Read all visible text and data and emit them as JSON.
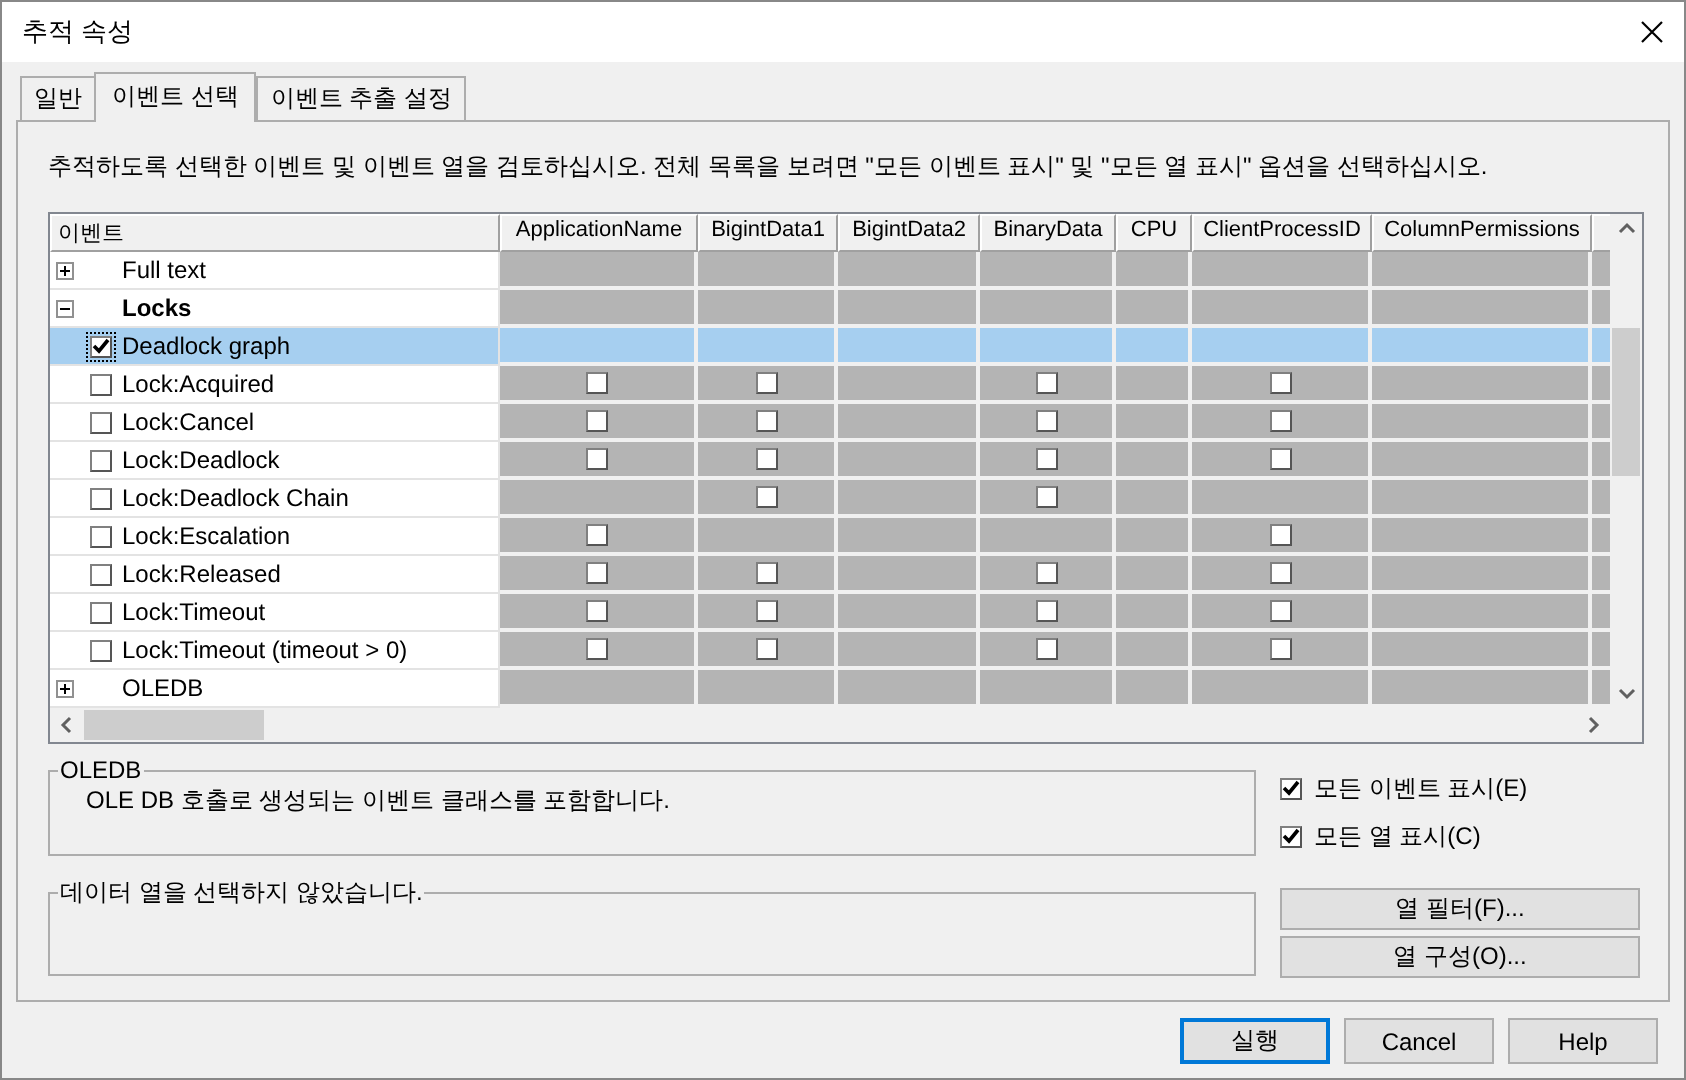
{
  "window": {
    "title": "추적 속성"
  },
  "tabs": [
    {
      "label": "일반",
      "selected": false
    },
    {
      "label": "이벤트 선택",
      "selected": true
    },
    {
      "label": "이벤트 추출 설정",
      "selected": false
    }
  ],
  "instructions": "추적하도록 선택한 이벤트 및 이벤트 열을 검토하십시오. 전체 목록을 보려면 \"모든 이벤트 표시\" 및 \"모든 열 표시\" 옵션을 선택하십시오.",
  "grid": {
    "event_header": "이벤트",
    "columns": [
      "ApplicationName",
      "BigintData1",
      "BigintData2",
      "BinaryData",
      "CPU",
      "ClientProcessID",
      "ColumnPermissions"
    ],
    "rows": [
      {
        "kind": "category",
        "label": "Full text",
        "expanded": false,
        "has_selected_events": false,
        "selected": false
      },
      {
        "kind": "category",
        "label": "Locks",
        "expanded": true,
        "has_selected_events": true,
        "selected": false
      },
      {
        "kind": "event",
        "label": "Deadlock graph",
        "checked": true,
        "selected": true,
        "cells": [
          {
            "kind": "blank"
          },
          {
            "kind": "blank"
          },
          {
            "kind": "blank"
          },
          {
            "kind": "blank"
          },
          {
            "kind": "blank"
          },
          {
            "kind": "blank"
          },
          {
            "kind": "blank"
          }
        ]
      },
      {
        "kind": "event",
        "label": "Lock:Acquired",
        "checked": false,
        "selected": false,
        "cells": [
          {
            "kind": "checkbox",
            "checked": false
          },
          {
            "kind": "checkbox",
            "checked": false
          },
          {
            "kind": "blank"
          },
          {
            "kind": "checkbox",
            "checked": false
          },
          {
            "kind": "blank"
          },
          {
            "kind": "checkbox",
            "checked": false
          },
          {
            "kind": "blank"
          }
        ]
      },
      {
        "kind": "event",
        "label": "Lock:Cancel",
        "checked": false,
        "selected": false,
        "cells": [
          {
            "kind": "checkbox",
            "checked": false
          },
          {
            "kind": "checkbox",
            "checked": false
          },
          {
            "kind": "blank"
          },
          {
            "kind": "checkbox",
            "checked": false
          },
          {
            "kind": "blank"
          },
          {
            "kind": "checkbox",
            "checked": false
          },
          {
            "kind": "blank"
          }
        ]
      },
      {
        "kind": "event",
        "label": "Lock:Deadlock",
        "checked": false,
        "selected": false,
        "cells": [
          {
            "kind": "checkbox",
            "checked": false
          },
          {
            "kind": "checkbox",
            "checked": false
          },
          {
            "kind": "blank"
          },
          {
            "kind": "checkbox",
            "checked": false
          },
          {
            "kind": "blank"
          },
          {
            "kind": "checkbox",
            "checked": false
          },
          {
            "kind": "blank"
          }
        ]
      },
      {
        "kind": "event",
        "label": "Lock:Deadlock Chain",
        "checked": false,
        "selected": false,
        "cells": [
          {
            "kind": "blank"
          },
          {
            "kind": "checkbox",
            "checked": false
          },
          {
            "kind": "blank"
          },
          {
            "kind": "checkbox",
            "checked": false
          },
          {
            "kind": "blank"
          },
          {
            "kind": "blank"
          },
          {
            "kind": "blank"
          }
        ]
      },
      {
        "kind": "event",
        "label": "Lock:Escalation",
        "checked": false,
        "selected": false,
        "cells": [
          {
            "kind": "checkbox",
            "checked": false
          },
          {
            "kind": "blank"
          },
          {
            "kind": "blank"
          },
          {
            "kind": "blank"
          },
          {
            "kind": "blank"
          },
          {
            "kind": "checkbox",
            "checked": false
          },
          {
            "kind": "blank"
          }
        ]
      },
      {
        "kind": "event",
        "label": "Lock:Released",
        "checked": false,
        "selected": false,
        "cells": [
          {
            "kind": "checkbox",
            "checked": false
          },
          {
            "kind": "checkbox",
            "checked": false
          },
          {
            "kind": "blank"
          },
          {
            "kind": "checkbox",
            "checked": false
          },
          {
            "kind": "blank"
          },
          {
            "kind": "checkbox",
            "checked": false
          },
          {
            "kind": "blank"
          }
        ]
      },
      {
        "kind": "event",
        "label": "Lock:Timeout",
        "checked": false,
        "selected": false,
        "cells": [
          {
            "kind": "checkbox",
            "checked": false
          },
          {
            "kind": "checkbox",
            "checked": false
          },
          {
            "kind": "blank"
          },
          {
            "kind": "checkbox",
            "checked": false
          },
          {
            "kind": "blank"
          },
          {
            "kind": "checkbox",
            "checked": false
          },
          {
            "kind": "blank"
          }
        ]
      },
      {
        "kind": "event",
        "label": "Lock:Timeout (timeout > 0)",
        "checked": false,
        "selected": false,
        "cells": [
          {
            "kind": "checkbox",
            "checked": false
          },
          {
            "kind": "checkbox",
            "checked": false
          },
          {
            "kind": "blank"
          },
          {
            "kind": "checkbox",
            "checked": false
          },
          {
            "kind": "blank"
          },
          {
            "kind": "checkbox",
            "checked": false
          },
          {
            "kind": "blank"
          }
        ]
      },
      {
        "kind": "category",
        "label": "OLEDB",
        "expanded": false,
        "has_selected_events": false,
        "selected": false
      }
    ]
  },
  "description_group": {
    "title": "OLEDB",
    "text": "OLE DB 호출로 생성되는 이벤트 클래스를 포함합니다."
  },
  "column_group": {
    "title": "데이터 열을 선택하지 않았습니다."
  },
  "options": [
    {
      "label": "모든 이벤트 표시(E)",
      "checked": true
    },
    {
      "label": "모든 열 표시(C)",
      "checked": true
    }
  ],
  "side_buttons": [
    "열 필터(F)...",
    "열 구성(O)..."
  ],
  "buttons": [
    {
      "label": "실행",
      "default": true
    },
    {
      "label": "Cancel",
      "default": false
    },
    {
      "label": "Help",
      "default": false
    }
  ]
}
